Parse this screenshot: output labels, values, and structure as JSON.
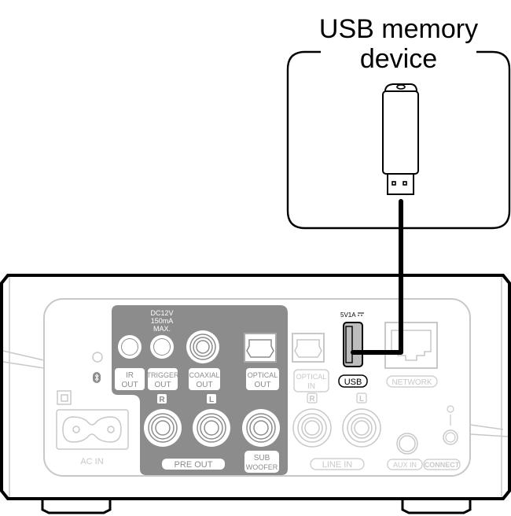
{
  "callout": {
    "title_line1": "USB memory",
    "title_line2": "device"
  },
  "colors": {
    "outline": "#000000",
    "panel_dark": "#8c8c8c",
    "panel_light": "#c8c8c8",
    "label_fill": "#ffffff",
    "connector_fill": "#bdbdbd"
  },
  "panel": {
    "dc_spec_line1": "DC12V",
    "dc_spec_line2": "150mA",
    "dc_spec_line3": "MAX.",
    "usb_rating": "5V1A",
    "labels": {
      "ir_out_1": "IR",
      "ir_out_2": "OUT",
      "trigger_out_1": "TRIGGER",
      "trigger_out_2": "OUT",
      "coaxial_out_1": "COAXIAL",
      "coaxial_out_2": "OUT",
      "optical_out_1": "OPTICAL",
      "optical_out_2": "OUT",
      "optical_in_1": "OPTICAL",
      "optical_in_2": "IN",
      "usb": "USB",
      "network": "NETWORK",
      "pre_out": "PRE OUT",
      "sub_woofer_1": "SUB",
      "sub_woofer_2": "WOOFER",
      "line_in": "LINE IN",
      "aux_in": "AUX IN",
      "connect": "CONNECT",
      "ac_in": "AC IN",
      "channel_r": "R",
      "channel_l": "L",
      "line_r": "R",
      "line_l": "L"
    }
  }
}
